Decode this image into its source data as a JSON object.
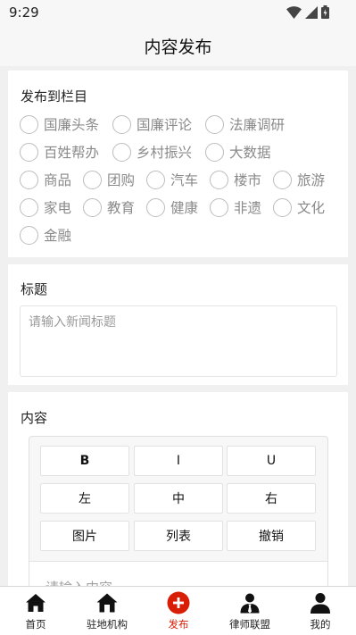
{
  "status_bar": {
    "time": "9:29"
  },
  "header": {
    "title": "内容发布"
  },
  "column_section": {
    "label": "发布到栏目",
    "options": [
      "国廉头条",
      "国廉评论",
      "法廉调研",
      "百姓帮办",
      "乡村振兴",
      "大数据",
      "商品",
      "团购",
      "汽车",
      "楼市",
      "旅游",
      "家电",
      "教育",
      "健康",
      "非遗",
      "文化",
      "金融"
    ]
  },
  "title_section": {
    "label": "标题",
    "placeholder": "请输入新闻标题"
  },
  "content_section": {
    "label": "内容",
    "toolbar": {
      "bold": "B",
      "italic": "I",
      "underline": "U",
      "align_left": "左",
      "align_center": "中",
      "align_right": "右",
      "image": "图片",
      "list": "列表",
      "undo": "撤销"
    },
    "placeholder": "请输入内容"
  },
  "tabbar": {
    "tabs": [
      {
        "label": "首页",
        "icon": "home-icon"
      },
      {
        "label": "驻地机构",
        "icon": "building-icon"
      },
      {
        "label": "发布",
        "icon": "publish-plus-icon",
        "active": true
      },
      {
        "label": "律师联盟",
        "icon": "lawyer-icon"
      },
      {
        "label": "我的",
        "icon": "user-icon"
      }
    ],
    "active_color": "#d81e06"
  }
}
